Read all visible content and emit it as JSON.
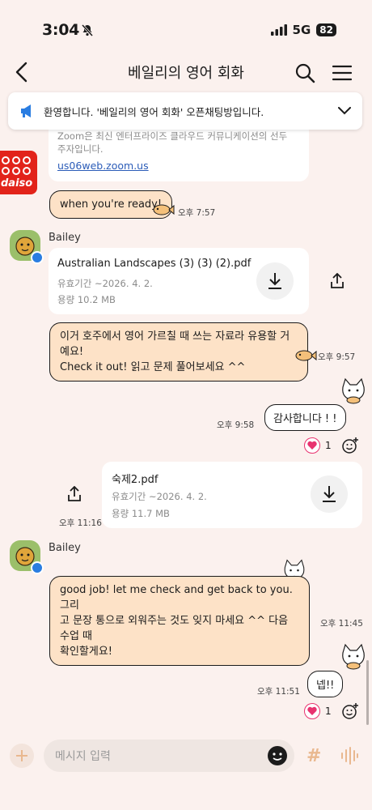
{
  "status": {
    "time": "3:04",
    "network": "5G",
    "battery": "82"
  },
  "header": {
    "title": "베일리의 영어 회화"
  },
  "notice": {
    "text": "환영합니다. '베일리의 영어 회화' 오픈채팅방입니다."
  },
  "link_card": {
    "description": "Zoom은 최신 엔터프라이즈 클라우드 커뮤니케이션의 선두주자입니다.",
    "description_line1": "Zoom은 최신 엔터프라이즈 클라우드 커뮤니케이션의 선두",
    "description_line2": "주자입니다.",
    "url": "us06web.zoom.us"
  },
  "sender_logo": "daiso",
  "messages": {
    "m1": {
      "text": "when you're ready!",
      "time": "오후 7:57"
    },
    "file1": {
      "sender": "Bailey",
      "filename": "Australian Landscapes (3) (3) (2).pdf",
      "expiry": "유효기간 ~2026. 4. 2.",
      "size": "용량  10.2 MB"
    },
    "m2": {
      "line1": "이거 호주에서 영어 가르칠 때 쓰는 자료라 유용할 거예요!",
      "line2": "Check it out! 읽고 문제 풀어보세요 ^^",
      "time": "오후 9:57"
    },
    "m3": {
      "text": "감사합니다 ! !",
      "time": "오후 9:58",
      "reaction_count": "1"
    },
    "file2": {
      "filename": "숙제2.pdf",
      "expiry": "유효기간 ~2026. 4. 2.",
      "size": "용량  11.7 MB",
      "time": "오후 11:16"
    },
    "m4": {
      "sender": "Bailey",
      "line1": "good job! let me check and get back to you. 그리",
      "line2": "고 문장 통으로 외워주는 것도 잊지 마세요 ^^ 다음 수업 때",
      "line3": "확인할게요!",
      "time": "오후 11:45"
    },
    "m5": {
      "text": "넵!!",
      "time": "오후 11:51",
      "reaction_count": "1"
    }
  },
  "input": {
    "placeholder": "메시지 입력"
  },
  "colors": {
    "bubble": "#fde2c7",
    "background": "#fbf1ee",
    "heart": "#e8336f",
    "accent": "#2a7de1"
  }
}
